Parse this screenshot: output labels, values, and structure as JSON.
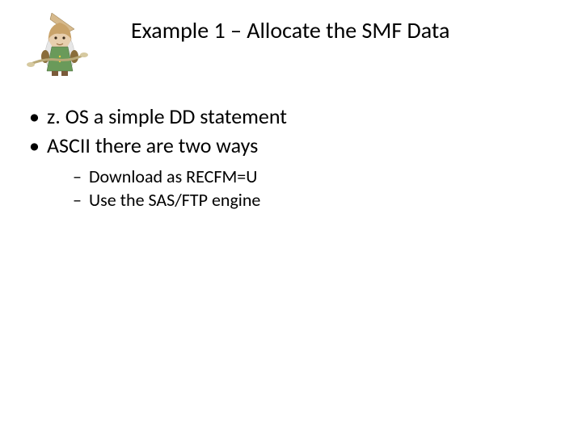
{
  "icon_name": "wizard-illustration",
  "title": "Example 1 – Allocate the SMF Data",
  "bullets": [
    {
      "text": "z. OS a simple DD statement",
      "sub": []
    },
    {
      "text": "ASCII there are two ways",
      "sub": [
        "Download as RECFM=U",
        "Use the SAS/FTP engine"
      ]
    }
  ]
}
